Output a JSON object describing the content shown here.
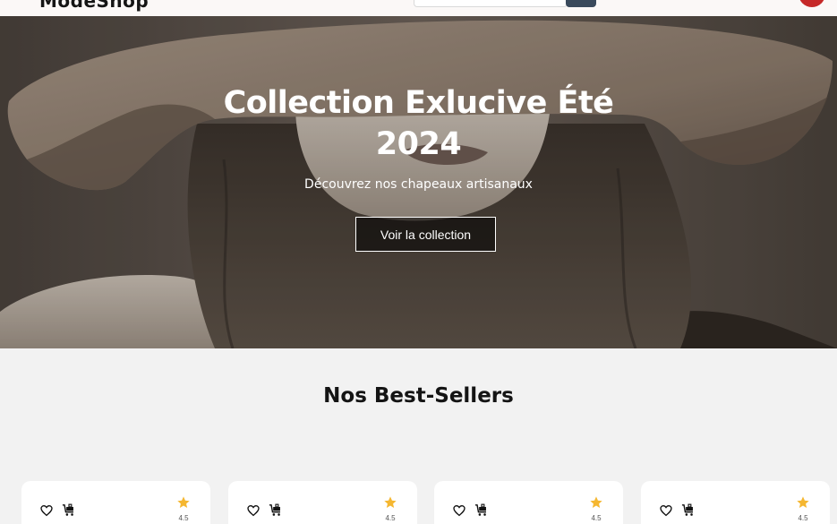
{
  "header": {
    "logo": "ModeShop",
    "search": {
      "placeholder": "",
      "value": ""
    }
  },
  "hero": {
    "title_line1": "Collection Exlucive Été",
    "title_line2": "2024",
    "subtitle": "Découvrez nos chapeaux artisanaux",
    "cta_label": "Voir la collection"
  },
  "best_sellers": {
    "title": "Nos Best-Sellers",
    "products": [
      {
        "rating": "4.5"
      },
      {
        "rating": "4.5"
      },
      {
        "rating": "4.5"
      },
      {
        "rating": "4.5"
      }
    ]
  },
  "colors": {
    "header_bg": "#fbf8f7",
    "search_button": "#3a4a5c",
    "avatar": "#c62828",
    "star": "#f5b731",
    "page_bg": "#f2f2f2"
  }
}
